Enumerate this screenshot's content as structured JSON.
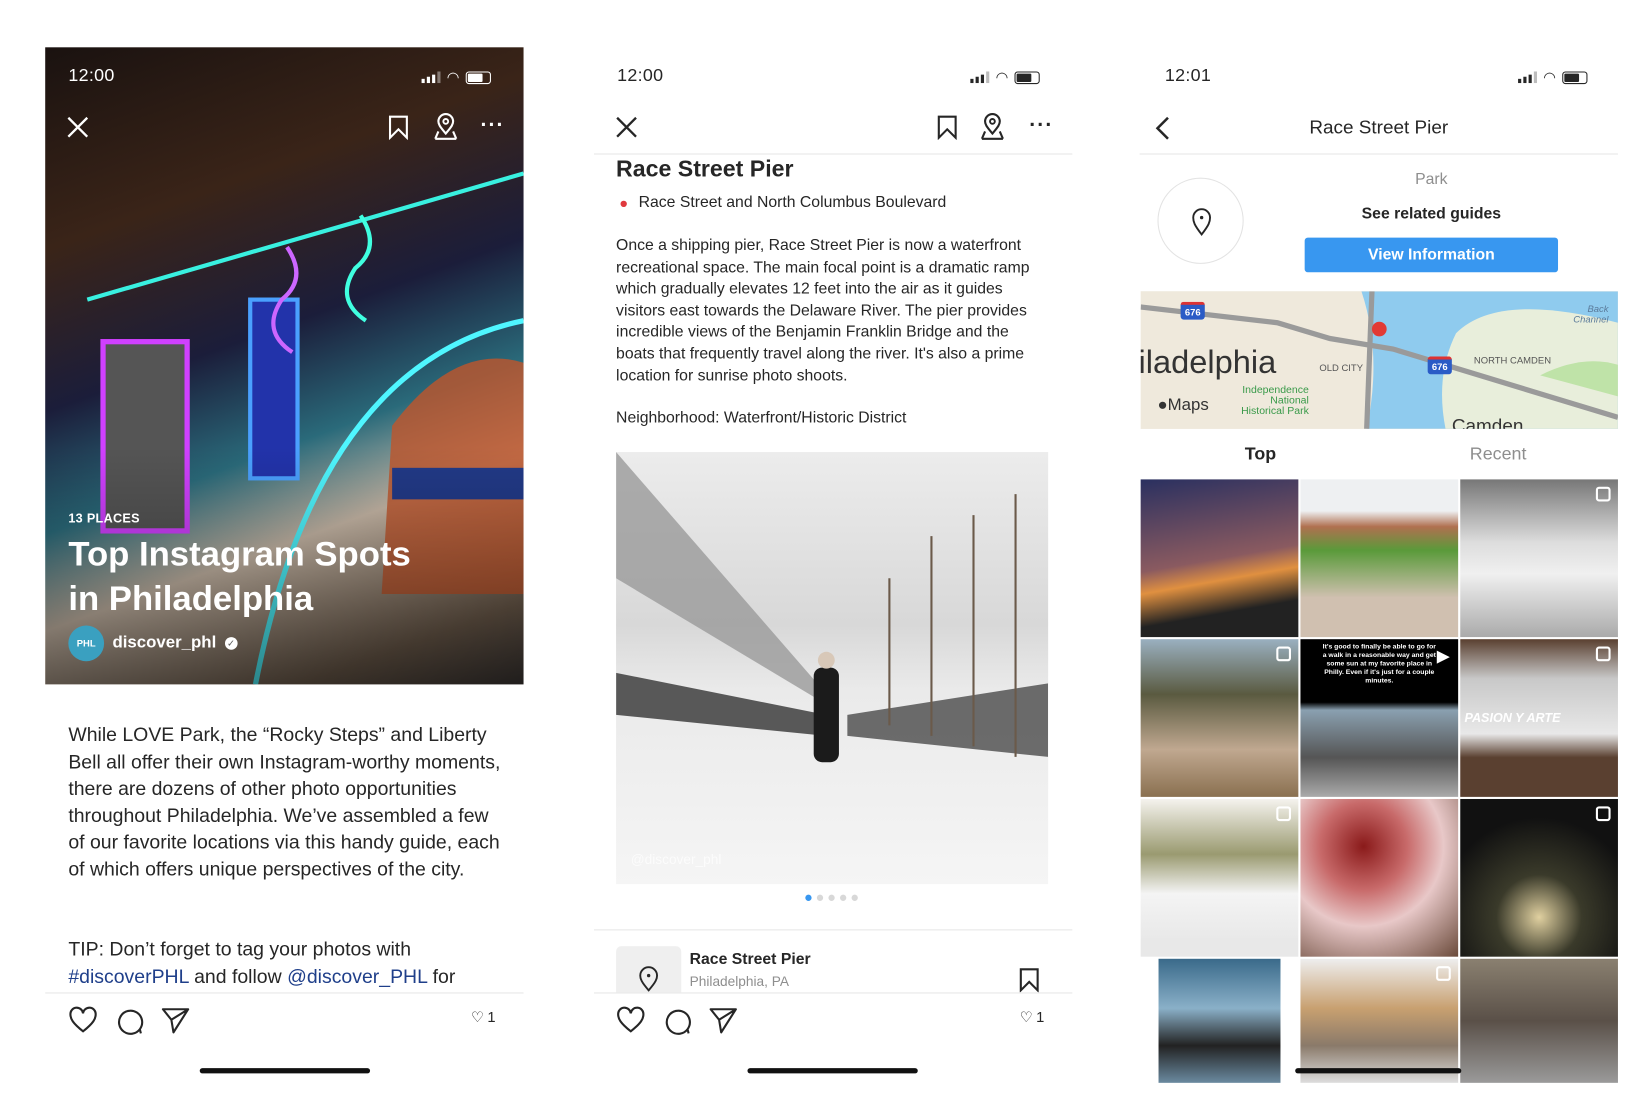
{
  "colors": {
    "accent_blue": "#3897f0",
    "link": "#1f3f8a",
    "text": "#262626",
    "muted": "#8e8e8e"
  },
  "screen1": {
    "status_time": "12:00",
    "icons": [
      "close-icon",
      "bookmark-icon",
      "map-pin-icon",
      "more-icon"
    ],
    "guide_count": "13 PLACES",
    "guide_title_line1": "Top Instagram Spots",
    "guide_title_line2": "in Philadelphia",
    "avatar_text": "PHL",
    "username": "discover_phl",
    "body": "While LOVE Park, the “Rocky Steps” and Liberty Bell all offer their own Instagram-worthy moments, there are dozens of other photo opportunities throughout Philadelphia. We’ve assembled a few of our favorite locations via this handy guide, each of which offers unique perspectives of the city.",
    "tip_prefix": "TIP: Don’t forget to tag your photos with",
    "hashtag": "#discoverPHL",
    "tip_mid": " and follow ",
    "mention": "@discover_PHL",
    "tip_end": " for",
    "likes": "1"
  },
  "screen2": {
    "status_time": "12:00",
    "place_title": "Race Street Pier",
    "address": "Race Street and North Columbus Boulevard",
    "description": "Once a shipping pier, Race Street Pier is now a waterfront recreational space. The main focal point is a dramatic ramp which gradually elevates 12 feet into the air as it guides visitors east towards the Delaware River. The pier provides incredible views of the Benjamin Franklin Bridge and the boats that frequently travel along the river. It's also a prime location for sunrise photo shoots.",
    "neighborhood": "Neighborhood: Waterfront/Historic District",
    "photo_watermark": "@discover_phl",
    "carousel": {
      "count": 5,
      "active": 1
    },
    "card_title": "Race Street Pier",
    "card_subtitle": "Philadelphia, PA",
    "likes": "1"
  },
  "screen3": {
    "status_time": "12:01",
    "title": "Race Street Pier",
    "category": "Park",
    "related": "See related guides",
    "button": "View Information",
    "map": {
      "city": "iladelphia",
      "old_city": "OLD CITY",
      "north_camden": "NORTH CAMDEN",
      "park": "Independence National Historical Park",
      "camden": "Camden",
      "back_channel": "Back Channel",
      "highway": "676",
      "attribution": "Maps"
    },
    "tabs": [
      {
        "label": "Top",
        "active": true
      },
      {
        "label": "Recent",
        "active": false
      }
    ],
    "video_caption": "It's good to finally be able to go for a walk in a reasonable way and get some sun at my favorite place in Philly. Even if it's just for a couple minutes.",
    "sign_text": "PASION Y ARTE"
  }
}
